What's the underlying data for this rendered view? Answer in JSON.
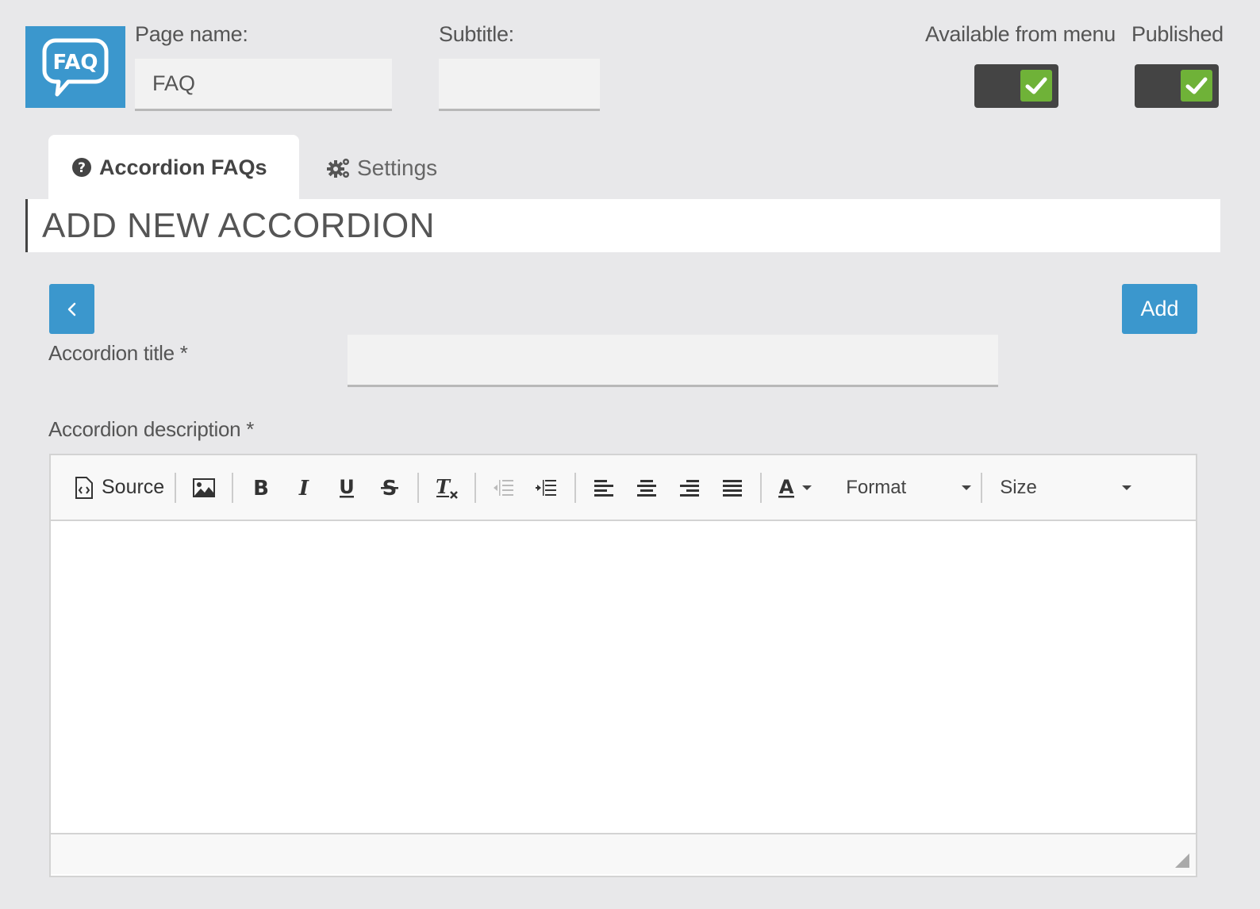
{
  "header": {
    "logo_text": "FAQ",
    "page_name_label": "Page name:",
    "page_name_value": "FAQ",
    "subtitle_label": "Subtitle:",
    "subtitle_value": "",
    "available_label": "Available from menu",
    "available_checked": true,
    "published_label": "Published",
    "published_checked": true
  },
  "tabs": [
    {
      "label": "Accordion FAQs",
      "icon": "question-circle-icon",
      "active": true
    },
    {
      "label": "Settings",
      "icon": "gears-icon",
      "active": false
    }
  ],
  "section": {
    "title": "ADD NEW ACCORDION"
  },
  "actions": {
    "back_icon": "chevron-left-icon",
    "add_label": "Add"
  },
  "form": {
    "title_label": "Accordion title *",
    "title_value": "",
    "description_label": "Accordion description *"
  },
  "editor": {
    "source_label": "Source",
    "format_label": "Format",
    "size_label": "Size"
  },
  "colors": {
    "accent": "#3b97cd",
    "toggle_bg": "#444444",
    "toggle_check": "#6fb238",
    "page_bg": "#e8e8ea"
  }
}
